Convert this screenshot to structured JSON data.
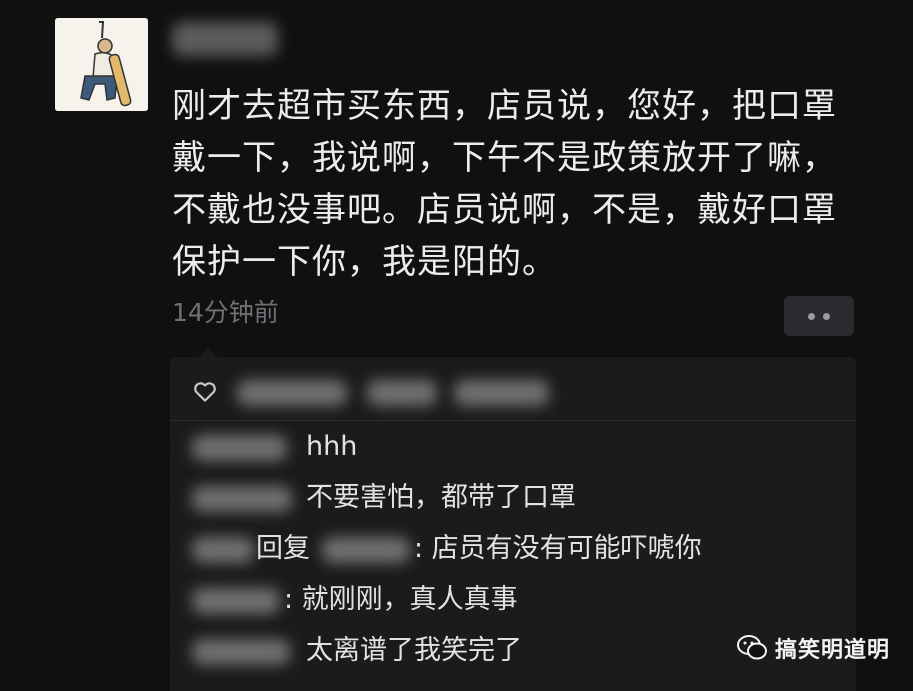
{
  "post": {
    "text": "刚才去超市买东西，店员说，您好，把口罩戴一下，我说啊，下午不是政策放开了嘛，不戴也没事吧。店员说啊，不是，戴好口罩保护一下你，我是阳的。",
    "timestamp": "14分钟前"
  },
  "comments": [
    {
      "text": "hhh"
    },
    {
      "text": "不要害怕，都带了口罩"
    },
    {
      "reply_word": "回复",
      "text": ": 店员有没有可能吓唬你"
    },
    {
      "text": ": 就刚刚，真人真事"
    },
    {
      "text": "太离谱了我笑完了"
    }
  ],
  "watermark": {
    "text": "搞笑明道明"
  }
}
